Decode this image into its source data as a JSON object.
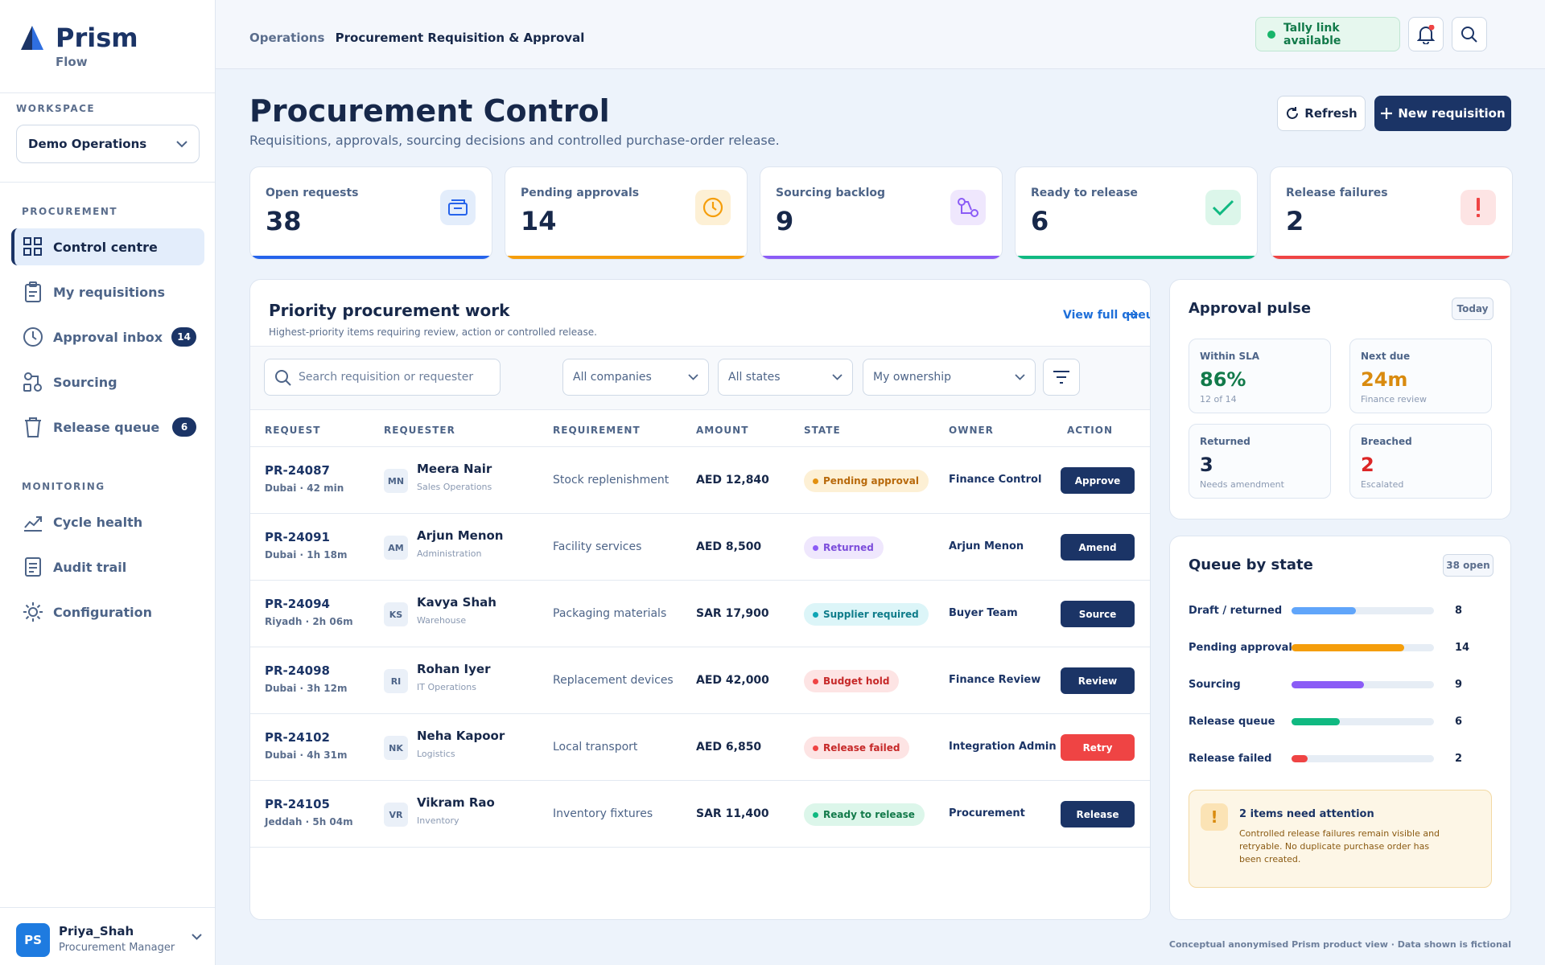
{
  "brand": {
    "name": "Prism",
    "sub": "Flow"
  },
  "workspace": {
    "label": "WORKSPACE",
    "value": "Demo Operations"
  },
  "sidebar": {
    "procurement_label": "PROCUREMENT",
    "monitoring_label": "MONITORING",
    "items": [
      {
        "label": "Control centre",
        "icon": "grid-icon",
        "active": true
      },
      {
        "label": "My requisitions",
        "icon": "clipboard-icon"
      },
      {
        "label": "Approval inbox",
        "icon": "clock-icon",
        "badge": "14"
      },
      {
        "label": "Sourcing",
        "icon": "sourcing-icon"
      },
      {
        "label": "Release queue",
        "icon": "bin-icon",
        "badge": "6"
      },
      {
        "label": "Cycle health",
        "icon": "trend-icon"
      },
      {
        "label": "Audit trail",
        "icon": "document-icon"
      },
      {
        "label": "Configuration",
        "icon": "gear-icon"
      }
    ]
  },
  "user": {
    "initials": "PS",
    "name": "Priya_Shah",
    "role": "Procurement Manager"
  },
  "topbar": {
    "crumb_section": "Operations",
    "crumb_page": "Procurement Requisition & Approval",
    "tally_status": "Tally link available"
  },
  "header": {
    "title": "Procurement Control",
    "subtitle": "Requisitions, approvals, sourcing decisions and controlled purchase-order release.",
    "refresh_label": "Refresh",
    "new_label": "New requisition"
  },
  "kpis": [
    {
      "label": "Open requests",
      "value": "38",
      "color": "#2563eb"
    },
    {
      "label": "Pending approvals",
      "value": "14",
      "color": "#f59e0b"
    },
    {
      "label": "Sourcing backlog",
      "value": "9",
      "color": "#8b5cf6"
    },
    {
      "label": "Ready to release",
      "value": "6",
      "color": "#10b981"
    },
    {
      "label": "Release failures",
      "value": "2",
      "color": "#ef4444"
    }
  ],
  "work": {
    "title": "Priority procurement work",
    "subtitle": "Highest-priority items requiring review, action or controlled release.",
    "view_link": "View full queue",
    "search_placeholder": "Search requisition or requester",
    "filters": {
      "company": "All companies",
      "state": "All states",
      "ownership": "My ownership"
    },
    "columns": [
      "REQUEST",
      "REQUESTER",
      "REQUIREMENT",
      "AMOUNT",
      "STATE",
      "OWNER",
      "ACTION"
    ],
    "rows": [
      {
        "id": "PR-24087",
        "loc": "Dubai · 42 min",
        "initials": "MN",
        "name": "Meera Nair",
        "dept": "Sales Operations",
        "requirement": "Stock replenishment",
        "amount": "AED 12,840",
        "state": "Pending approval",
        "owner": "Finance Control",
        "action": "Approve"
      },
      {
        "id": "PR-24091",
        "loc": "Dubai · 1h 18m",
        "initials": "AM",
        "name": "Arjun Menon",
        "dept": "Administration",
        "requirement": "Facility services",
        "amount": "AED 8,500",
        "state": "Returned",
        "owner": "Arjun Menon",
        "action": "Amend"
      },
      {
        "id": "PR-24094",
        "loc": "Riyadh · 2h 06m",
        "initials": "KS",
        "name": "Kavya Shah",
        "dept": "Warehouse",
        "requirement": "Packaging materials",
        "amount": "SAR 17,900",
        "state": "Supplier required",
        "owner": "Buyer Team",
        "action": "Source"
      },
      {
        "id": "PR-24098",
        "loc": "Dubai · 3h 12m",
        "initials": "RI",
        "name": "Rohan Iyer",
        "dept": "IT Operations",
        "requirement": "Replacement devices",
        "amount": "AED 42,000",
        "state": "Budget hold",
        "owner": "Finance Review",
        "action": "Review"
      },
      {
        "id": "PR-24102",
        "loc": "Dubai · 4h 31m",
        "initials": "NK",
        "name": "Neha Kapoor",
        "dept": "Logistics",
        "requirement": "Local transport",
        "amount": "AED 6,850",
        "state": "Release failed",
        "owner": "Integration Admin",
        "action": "Retry"
      },
      {
        "id": "PR-24105",
        "loc": "Jeddah · 5h 04m",
        "initials": "VR",
        "name": "Vikram Rao",
        "dept": "Inventory",
        "requirement": "Inventory fixtures",
        "amount": "SAR 11,400",
        "state": "Ready to release",
        "owner": "Procurement",
        "action": "Release"
      }
    ]
  },
  "pulse": {
    "title": "Approval pulse",
    "chip": "Today",
    "tiles": [
      {
        "label": "Within SLA",
        "value": "86%",
        "sub": "12 of 14",
        "color": "#127a4a"
      },
      {
        "label": "Next due",
        "value": "24m",
        "sub": "Finance review",
        "color": "#d98b0f"
      },
      {
        "label": "Returned",
        "value": "3",
        "sub": "Needs amendment",
        "color": "#17284a"
      },
      {
        "label": "Breached",
        "value": "2",
        "sub": "Escalated",
        "color": "#dc2626"
      }
    ]
  },
  "queue": {
    "title": "Queue by state",
    "chip": "38 open",
    "rows": [
      {
        "label": "Draft / returned",
        "value": "8",
        "color": "#60a5fa"
      },
      {
        "label": "Pending approval",
        "value": "14",
        "color": "#f59e0b"
      },
      {
        "label": "Sourcing",
        "value": "9",
        "color": "#8b5cf6"
      },
      {
        "label": "Release queue",
        "value": "6",
        "color": "#10b981"
      },
      {
        "label": "Release failed",
        "value": "2",
        "color": "#ef4444"
      }
    ],
    "alert_title": "2 items need attention",
    "alert_body": "Controlled release failures remain visible and retryable. No duplicate purchase order has been created."
  },
  "footer_note": "Conceptual anonymised Prism product view · Data shown is fictional"
}
